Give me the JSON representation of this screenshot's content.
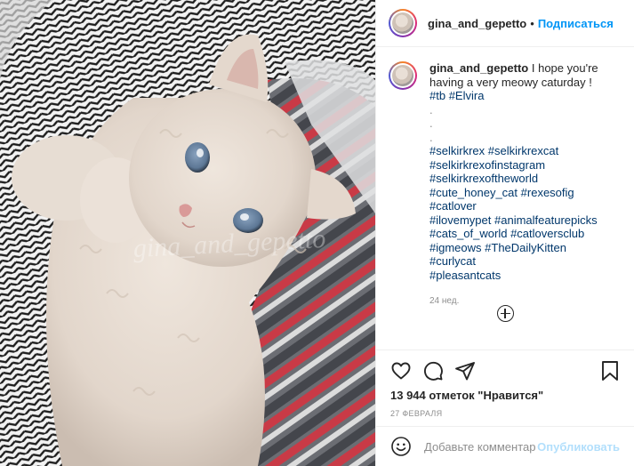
{
  "header": {
    "username": "gina_and_gepetto",
    "separator": "•",
    "follow_label": "Подписаться"
  },
  "caption": {
    "username": "gina_and_gepetto",
    "text": "I hope you're having a very meowy caturday !",
    "inline_tags": [
      "#tb",
      "#Elvira"
    ],
    "dots": [
      ".",
      ".",
      "."
    ],
    "hashtag_lines": [
      [
        "#selkirkrex",
        "#selkirkrexcat"
      ],
      [
        "#selkirkrexofinstagram"
      ],
      [
        "#selkirkrexoftheworld"
      ],
      [
        "#cute_honey_cat",
        "#rexesofig",
        "#catlover"
      ],
      [
        "#ilovemypet",
        "#animalfeaturepicks"
      ],
      [
        "#cats_of_world",
        "#catloversclub"
      ],
      [
        "#igmeows",
        "#TheDailyKitten",
        "#curlycat"
      ],
      [
        "#pleasantcats"
      ]
    ],
    "time_ago": "24 нед."
  },
  "load_more_icon": "plus-circle-icon",
  "actions": {
    "icons": [
      "heart-icon",
      "comment-icon",
      "share-icon",
      "bookmark-icon"
    ],
    "likes": "13 944 отметок \"Нравится\"",
    "date": "27 ФЕВРАЛЯ"
  },
  "add_comment": {
    "emoji_icon": "smiley-icon",
    "placeholder": "Добавьте комментарий...",
    "publish_label": "Опубликовать"
  },
  "photo": {
    "watermark": "gina_and_gepetto",
    "colors": {
      "fur": "#e6dbd1",
      "eyes": "#5d7795",
      "blanket_red": "#c93a46",
      "follow": "#0095f6"
    }
  }
}
